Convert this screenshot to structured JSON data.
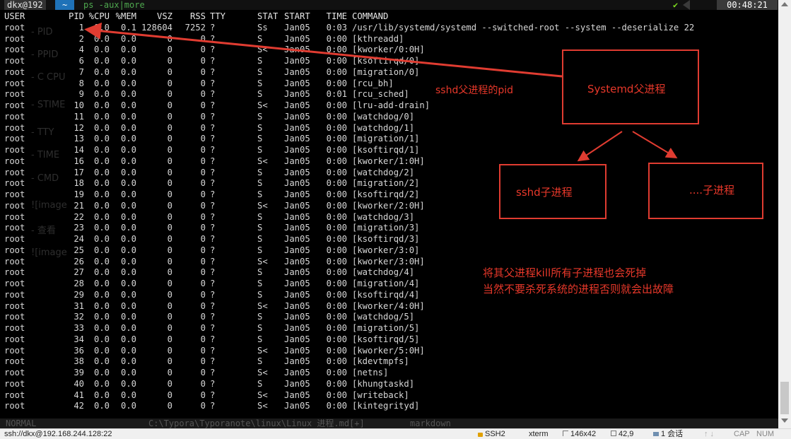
{
  "prompt": {
    "user_host": "dkx@192",
    "dir": "~",
    "command": "ps -aux|more",
    "check": "✔",
    "clock": "00:48:21"
  },
  "ps": {
    "headers": [
      "USER",
      "PID",
      "%CPU",
      "%MEM",
      "VSZ",
      "RSS",
      "TTY",
      "STAT",
      "START",
      "TIME",
      "COMMAND"
    ],
    "rows": [
      [
        "root",
        "1",
        "0.0",
        "0.1",
        "128604",
        "7252",
        "?",
        "Ss",
        "Jan05",
        "0:03",
        "/usr/lib/systemd/systemd --switched-root --system --deserialize 22"
      ],
      [
        "root",
        "2",
        "0.0",
        "0.0",
        "0",
        "0",
        "?",
        "S",
        "Jan05",
        "0:00",
        "[kthreadd]"
      ],
      [
        "root",
        "4",
        "0.0",
        "0.0",
        "0",
        "0",
        "?",
        "S<",
        "Jan05",
        "0:00",
        "[kworker/0:0H]"
      ],
      [
        "root",
        "6",
        "0.0",
        "0.0",
        "0",
        "0",
        "?",
        "S",
        "Jan05",
        "0:00",
        "[ksoftirqd/0]"
      ],
      [
        "root",
        "7",
        "0.0",
        "0.0",
        "0",
        "0",
        "?",
        "S",
        "Jan05",
        "0:00",
        "[migration/0]"
      ],
      [
        "root",
        "8",
        "0.0",
        "0.0",
        "0",
        "0",
        "?",
        "S",
        "Jan05",
        "0:00",
        "[rcu_bh]"
      ],
      [
        "root",
        "9",
        "0.0",
        "0.0",
        "0",
        "0",
        "?",
        "S",
        "Jan05",
        "0:01",
        "[rcu_sched]"
      ],
      [
        "root",
        "10",
        "0.0",
        "0.0",
        "0",
        "0",
        "?",
        "S<",
        "Jan05",
        "0:00",
        "[lru-add-drain]"
      ],
      [
        "root",
        "11",
        "0.0",
        "0.0",
        "0",
        "0",
        "?",
        "S",
        "Jan05",
        "0:00",
        "[watchdog/0]"
      ],
      [
        "root",
        "12",
        "0.0",
        "0.0",
        "0",
        "0",
        "?",
        "S",
        "Jan05",
        "0:00",
        "[watchdog/1]"
      ],
      [
        "root",
        "13",
        "0.0",
        "0.0",
        "0",
        "0",
        "?",
        "S",
        "Jan05",
        "0:00",
        "[migration/1]"
      ],
      [
        "root",
        "14",
        "0.0",
        "0.0",
        "0",
        "0",
        "?",
        "S",
        "Jan05",
        "0:00",
        "[ksoftirqd/1]"
      ],
      [
        "root",
        "16",
        "0.0",
        "0.0",
        "0",
        "0",
        "?",
        "S<",
        "Jan05",
        "0:00",
        "[kworker/1:0H]"
      ],
      [
        "root",
        "17",
        "0.0",
        "0.0",
        "0",
        "0",
        "?",
        "S",
        "Jan05",
        "0:00",
        "[watchdog/2]"
      ],
      [
        "root",
        "18",
        "0.0",
        "0.0",
        "0",
        "0",
        "?",
        "S",
        "Jan05",
        "0:00",
        "[migration/2]"
      ],
      [
        "root",
        "19",
        "0.0",
        "0.0",
        "0",
        "0",
        "?",
        "S",
        "Jan05",
        "0:00",
        "[ksoftirqd/2]"
      ],
      [
        "root",
        "21",
        "0.0",
        "0.0",
        "0",
        "0",
        "?",
        "S<",
        "Jan05",
        "0:00",
        "[kworker/2:0H]"
      ],
      [
        "root",
        "22",
        "0.0",
        "0.0",
        "0",
        "0",
        "?",
        "S",
        "Jan05",
        "0:00",
        "[watchdog/3]"
      ],
      [
        "root",
        "23",
        "0.0",
        "0.0",
        "0",
        "0",
        "?",
        "S",
        "Jan05",
        "0:00",
        "[migration/3]"
      ],
      [
        "root",
        "24",
        "0.0",
        "0.0",
        "0",
        "0",
        "?",
        "S",
        "Jan05",
        "0:00",
        "[ksoftirqd/3]"
      ],
      [
        "root",
        "25",
        "0.0",
        "0.0",
        "0",
        "0",
        "?",
        "S",
        "Jan05",
        "0:00",
        "[kworker/3:0]"
      ],
      [
        "root",
        "26",
        "0.0",
        "0.0",
        "0",
        "0",
        "?",
        "S<",
        "Jan05",
        "0:00",
        "[kworker/3:0H]"
      ],
      [
        "root",
        "27",
        "0.0",
        "0.0",
        "0",
        "0",
        "?",
        "S",
        "Jan05",
        "0:00",
        "[watchdog/4]"
      ],
      [
        "root",
        "28",
        "0.0",
        "0.0",
        "0",
        "0",
        "?",
        "S",
        "Jan05",
        "0:00",
        "[migration/4]"
      ],
      [
        "root",
        "29",
        "0.0",
        "0.0",
        "0",
        "0",
        "?",
        "S",
        "Jan05",
        "0:00",
        "[ksoftirqd/4]"
      ],
      [
        "root",
        "31",
        "0.0",
        "0.0",
        "0",
        "0",
        "?",
        "S<",
        "Jan05",
        "0:00",
        "[kworker/4:0H]"
      ],
      [
        "root",
        "32",
        "0.0",
        "0.0",
        "0",
        "0",
        "?",
        "S",
        "Jan05",
        "0:00",
        "[watchdog/5]"
      ],
      [
        "root",
        "33",
        "0.0",
        "0.0",
        "0",
        "0",
        "?",
        "S",
        "Jan05",
        "0:00",
        "[migration/5]"
      ],
      [
        "root",
        "34",
        "0.0",
        "0.0",
        "0",
        "0",
        "?",
        "S",
        "Jan05",
        "0:00",
        "[ksoftirqd/5]"
      ],
      [
        "root",
        "36",
        "0.0",
        "0.0",
        "0",
        "0",
        "?",
        "S<",
        "Jan05",
        "0:00",
        "[kworker/5:0H]"
      ],
      [
        "root",
        "38",
        "0.0",
        "0.0",
        "0",
        "0",
        "?",
        "S",
        "Jan05",
        "0:00",
        "[kdevtmpfs]"
      ],
      [
        "root",
        "39",
        "0.0",
        "0.0",
        "0",
        "0",
        "?",
        "S<",
        "Jan05",
        "0:00",
        "[netns]"
      ],
      [
        "root",
        "40",
        "0.0",
        "0.0",
        "0",
        "0",
        "?",
        "S",
        "Jan05",
        "0:00",
        "[khungtaskd]"
      ],
      [
        "root",
        "41",
        "0.0",
        "0.0",
        "0",
        "0",
        "?",
        "S<",
        "Jan05",
        "0:00",
        "[writeback]"
      ],
      [
        "root",
        "42",
        "0.0",
        "0.0",
        "0",
        "0",
        "?",
        "S<",
        "Jan05",
        "0:00",
        "[kintegrityd]"
      ]
    ]
  },
  "ghost_lines": [
    "- PID",
    "- PPID",
    "- C CPU",
    "- STIME",
    "- TTY",
    "- TIME",
    "- CMD",
    "![image",
    "- 查看",
    "![image"
  ],
  "annotations": {
    "arrow_label": "sshd父进程的pid",
    "box_parent": "Systemd父进程",
    "box_child_sshd": "sshd子进程",
    "box_child_other": "....子进程",
    "note_line1": "将其父进程kill所有子进程也会死掉",
    "note_line2": "当然不要杀死系统的进程否则就会出故障",
    "color": "#e03c31"
  },
  "vim_status": {
    "left": "NORMAL",
    "file": "C:\\Typora\\Typoranote\\linux\\Linux 进程.md[+]",
    "mode": "markdown"
  },
  "statusbar": {
    "connection": "ssh://dkx@192.168.244.128:22",
    "protocol": "SSH2",
    "term": "xterm",
    "size": "146x42",
    "pos": "42,9",
    "sessions": "1 会话",
    "caps": "CAP",
    "num": "NUM"
  }
}
